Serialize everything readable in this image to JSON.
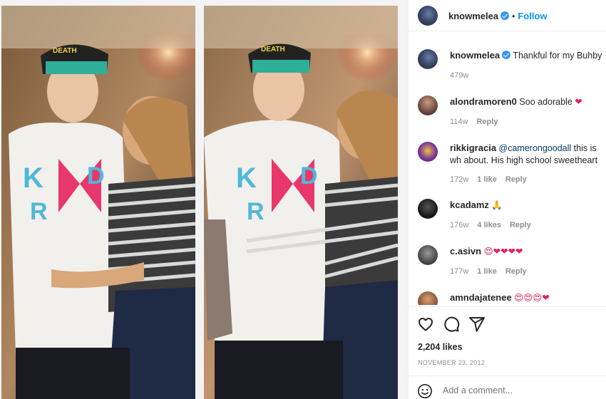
{
  "header": {
    "username": "knowmelea",
    "verified_icon": "verified-badge-icon",
    "separator": "•",
    "follow_label": "Follow"
  },
  "caption": {
    "username": "knowmelea",
    "text": "Thankful for my Buhby",
    "time": "479w"
  },
  "comments": [
    {
      "username": "alondramoren0",
      "text": "Soo adorable",
      "emoji": "❤",
      "time": "114w",
      "likes": "",
      "reply": "Reply"
    },
    {
      "username": "rikkigracia",
      "mention": "@camerongoodall",
      "text": "this is wh about. His high school sweetheart",
      "time": "172w",
      "likes": "1 like",
      "reply": "Reply"
    },
    {
      "username": "kcadamz",
      "text": "",
      "emoji": "🙏",
      "time": "176w",
      "likes": "4 likes",
      "reply": "Reply"
    },
    {
      "username": "c.asivn",
      "text": "",
      "emoji": "😍❤❤❤❤",
      "time": "177w",
      "likes": "1 like",
      "reply": "Reply"
    },
    {
      "username": "amndajatenee",
      "text": "",
      "emoji": "😍😍😍❤",
      "time": "",
      "likes": "",
      "reply": ""
    }
  ],
  "actions": {
    "like_icon": "heart-icon",
    "comment_icon": "comment-icon",
    "share_icon": "share-icon",
    "likes_count": "2,204 likes",
    "date": "NOVEMBER 23, 2012"
  },
  "add_comment": {
    "placeholder": "Add a comment...",
    "emoji_icon": "smiley-icon"
  },
  "colors": {
    "accent": "#0095f6",
    "heart": "#e0245e",
    "muted": "#8e8e8e"
  }
}
